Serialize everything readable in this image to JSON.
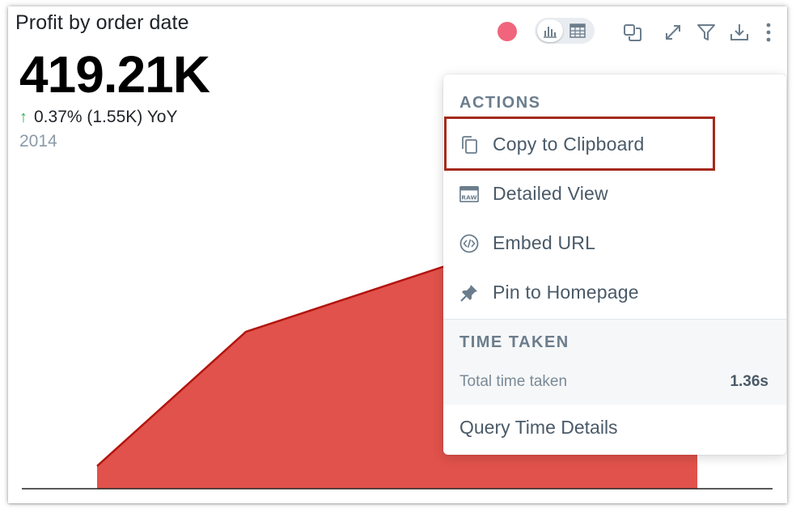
{
  "card": {
    "title": "Profit by order date",
    "kpi_value": "419.21K",
    "change_arrow": "↑",
    "change_text": "0.37% (1.55K) YoY",
    "period": "2014"
  },
  "toolbar": {
    "icons": [
      "record-dot",
      "bar-chart-icon",
      "table-icon",
      "copy-frame-icon",
      "expand-icon",
      "filter-icon",
      "download-icon",
      "more-vertical-icon"
    ]
  },
  "menu": {
    "actions_title": "ACTIONS",
    "items": [
      {
        "label": "Copy to Clipboard",
        "icon": "copy-icon"
      },
      {
        "label": "Detailed View",
        "icon": "raw-data-icon"
      },
      {
        "label": "Embed URL",
        "icon": "code-icon"
      },
      {
        "label": "Pin to Homepage",
        "icon": "pin-icon"
      }
    ],
    "time_title": "TIME TAKEN",
    "time_label": "Total time taken",
    "time_value": "1.36s",
    "query_details": "Query Time Details"
  },
  "colors": {
    "area_fill": "#e0524b",
    "area_stroke": "#b3140e",
    "record_dot": "#f0657c",
    "highlight": "#a42a1c",
    "up_arrow": "#3aa757"
  }
}
